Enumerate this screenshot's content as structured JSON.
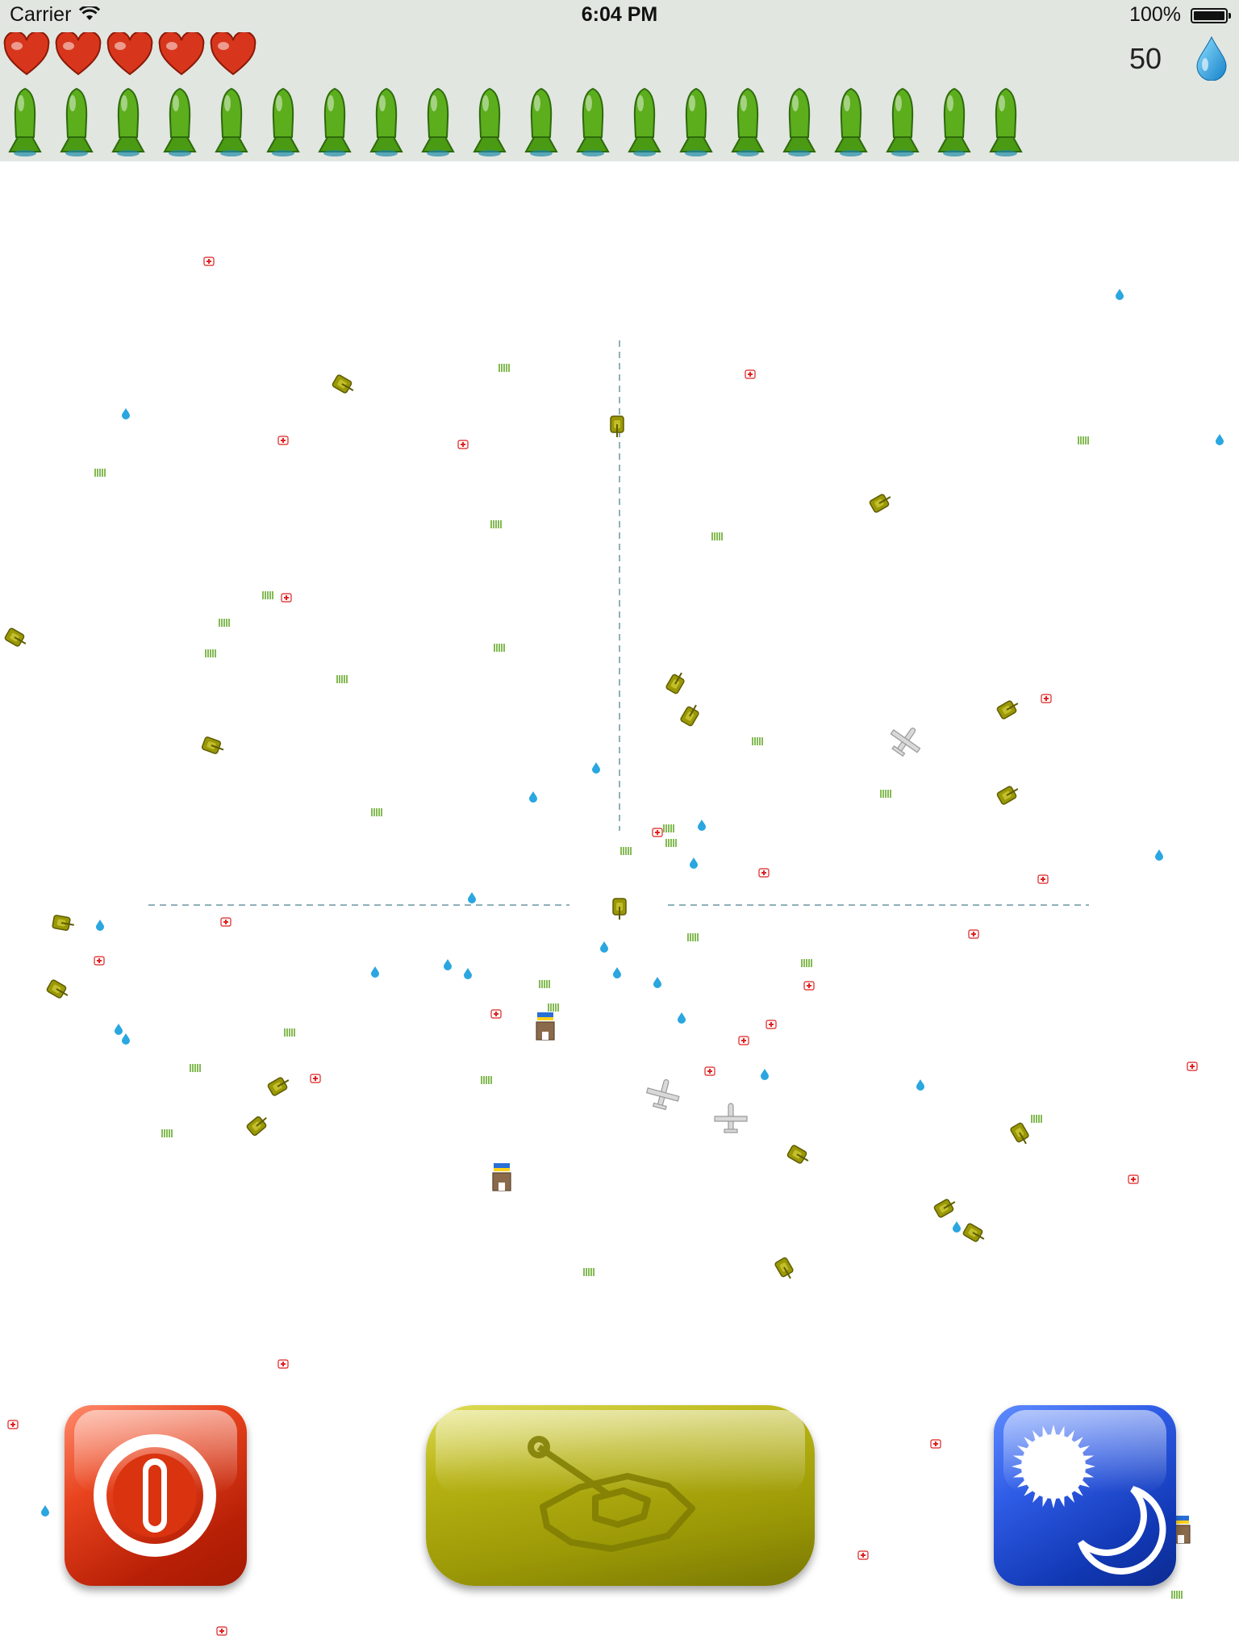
{
  "status_bar": {
    "carrier": "Carrier",
    "time": "6:04 PM",
    "battery": "100%"
  },
  "hud": {
    "lives": 5,
    "bombs": 20,
    "water_count": "50"
  },
  "colors": {
    "hud_bg": "#e1e6e1",
    "heart": "#d8361c",
    "bomb": "#5cae1d",
    "water": "#2aa6e0",
    "power_button": "#d9330f",
    "fire_button": "#a7a30a",
    "daynight_button": "#1f4ad3",
    "crosshair": "#8fb0b8"
  },
  "icons": {
    "lives": "heart-icon",
    "bombs": "bomb-icon",
    "water": "water-drop-icon",
    "power": "power-icon",
    "fire": "tank-icon",
    "daynight": "sun-moon-icon"
  },
  "field_objects": {
    "tank": "tank-icon",
    "plane": "plane-icon",
    "medkit": "medkit-icon",
    "grass": "grass-icon",
    "water": "water-drop-icon",
    "tower": "tower-icon"
  }
}
